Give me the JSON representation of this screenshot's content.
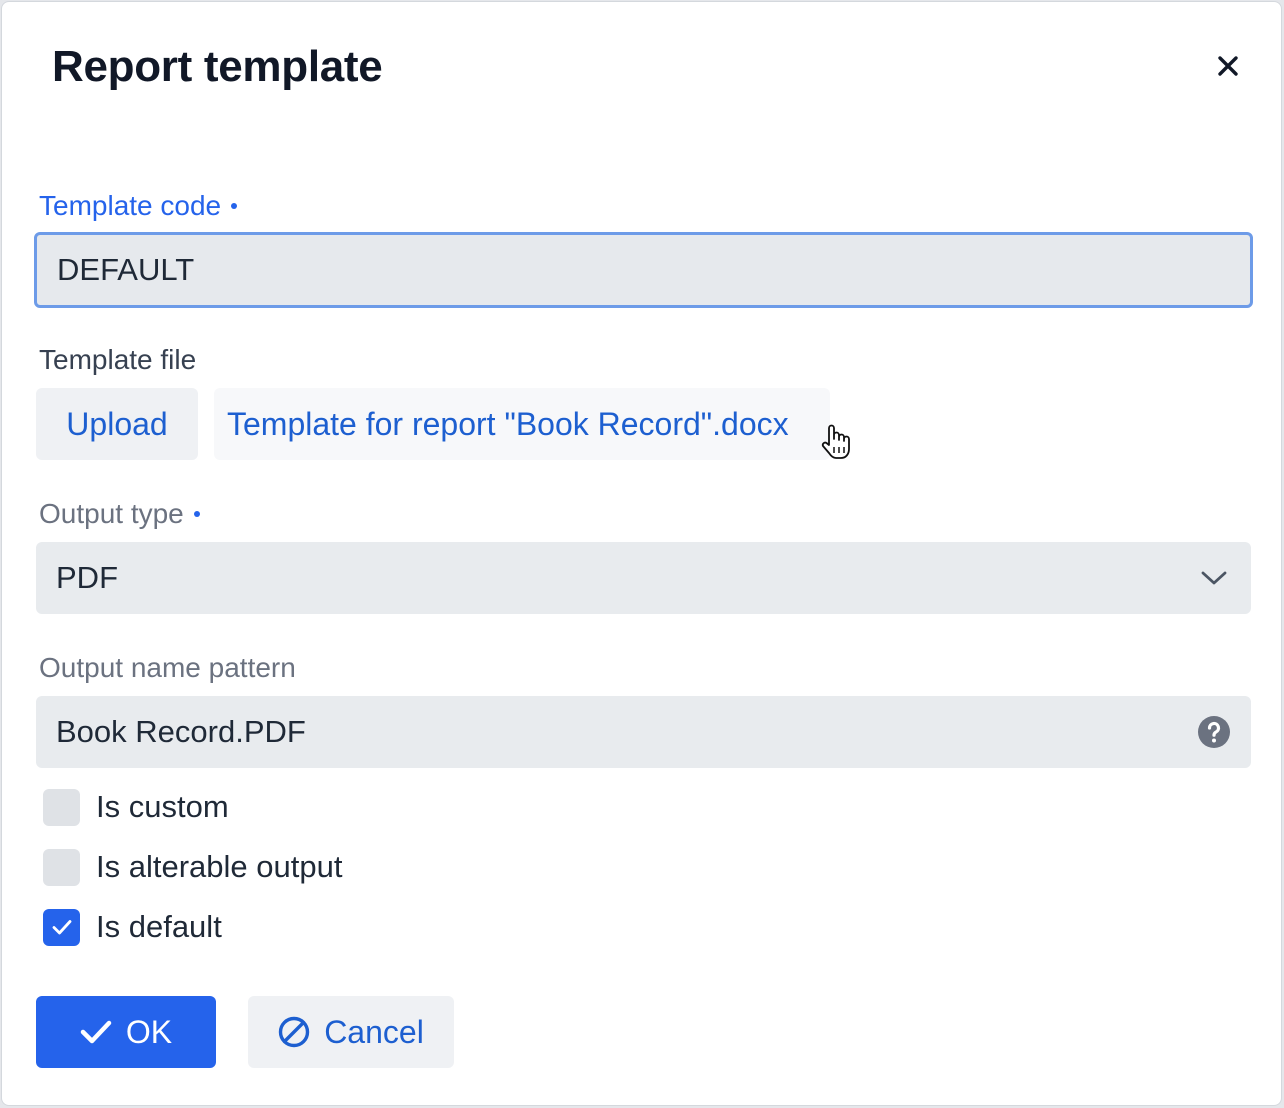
{
  "dialog": {
    "title": "Report template",
    "close_icon": "close-icon"
  },
  "template_code": {
    "label": "Template code",
    "value": "DEFAULT",
    "required": true
  },
  "template_file": {
    "label": "Template file",
    "upload_label": "Upload",
    "file_name": "Template for report \"Book Record\".docx"
  },
  "output_type": {
    "label": "Output type",
    "value": "PDF",
    "required": true,
    "icon": "chevron-down-icon"
  },
  "output_name_pattern": {
    "label": "Output name pattern",
    "value": "Book Record.PDF",
    "icon": "help-circle-icon"
  },
  "options": {
    "is_custom": {
      "label": "Is custom",
      "checked": false
    },
    "is_alterable_output": {
      "label": "Is alterable output",
      "checked": false
    },
    "is_default": {
      "label": "Is default",
      "checked": true
    }
  },
  "actions": {
    "ok_label": "OK",
    "cancel_label": "Cancel"
  },
  "colors": {
    "accent": "#2563eb",
    "link": "#1d5fd0",
    "field_bg": "#e8ebee",
    "focus_border": "#6d9be8"
  }
}
